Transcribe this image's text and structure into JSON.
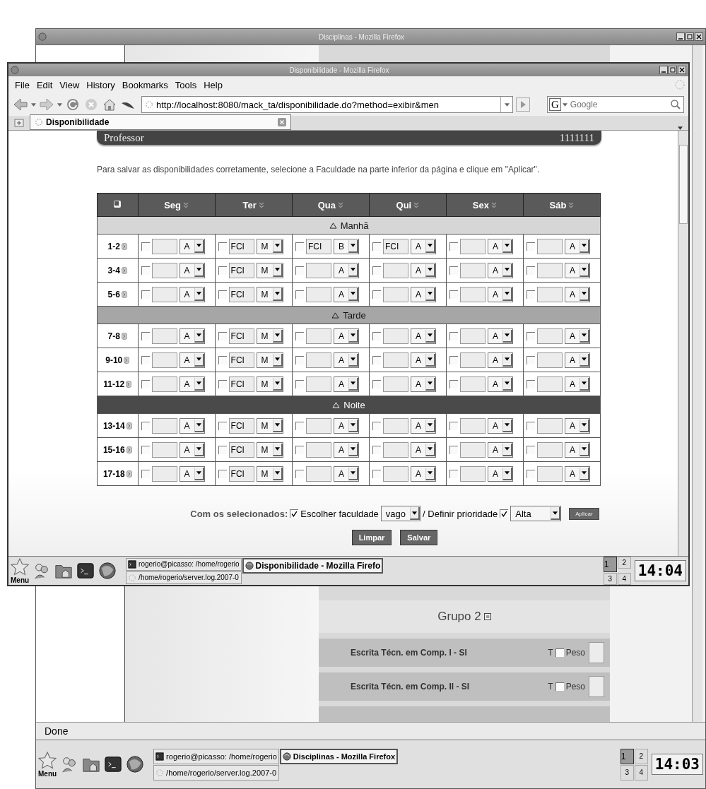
{
  "back_window": {
    "title": "Disciplinas - Mozilla Firefox",
    "group_title": "Grupo 2",
    "subjects": [
      {
        "name": "Escrita Técn. em Comp. I - SI",
        "t_label": "T",
        "checked": false,
        "weight_label": "Peso"
      },
      {
        "name": "Escrita Técn. em Comp. II - SI",
        "t_label": "T",
        "checked": false,
        "weight_label": "Peso"
      }
    ],
    "status": "Done",
    "taskbar": {
      "menu": "Menu",
      "tasks": [
        {
          "label": "rogerio@picasso: /home/rogerio",
          "kind": "terminal",
          "selected": false
        },
        {
          "label": "/home/rogerio/server.log.2007-0",
          "kind": "file",
          "selected": false
        },
        {
          "label": "Disciplinas - Mozilla Firefox",
          "kind": "browser",
          "selected": true
        }
      ],
      "workspaces": [
        {
          "label": "1",
          "selected": true
        },
        {
          "label": "2",
          "selected": false
        },
        {
          "label": "3",
          "selected": false
        },
        {
          "label": "4",
          "selected": false
        }
      ],
      "clock": "14:03"
    }
  },
  "front_window": {
    "title": "Disponibilidade - Mozilla Firefox",
    "menu": [
      "File",
      "Edit",
      "View",
      "History",
      "Bookmarks",
      "Tools",
      "Help"
    ],
    "url": "http://localhost:8080/mack_ta/disponibilidade.do?method=exibir&men",
    "search_engine": "G",
    "search_placeholder": "Google",
    "tab": {
      "label": "Disponibilidade",
      "selected": true
    },
    "page": {
      "header_title": "Professor",
      "header_id": "1111111",
      "instruction": "Para salvar as disponibilidades corretamente, selecione a Faculdade na parte inferior da página e clique em \"Aplicar\".",
      "columns": [
        "Seg",
        "Ter",
        "Qua",
        "Qui",
        "Sex",
        "Sáb"
      ],
      "sections": [
        {
          "label": "Manhã",
          "color": "#d6d6d6",
          "rows": [
            {
              "label": "1-2",
              "cells": [
                {
                  "checked": false,
                  "priority": "A"
                },
                {
                  "checked": false,
                  "faculty": "FCI",
                  "priority": "M"
                },
                {
                  "checked": false,
                  "faculty": "FCI",
                  "priority": "B"
                },
                {
                  "checked": false,
                  "faculty": "FCI",
                  "priority": "A"
                },
                {
                  "checked": false,
                  "priority": "A"
                },
                {
                  "checked": false,
                  "priority": "A"
                }
              ]
            },
            {
              "label": "3-4",
              "cells": [
                {
                  "checked": false,
                  "priority": "A"
                },
                {
                  "checked": false,
                  "faculty": "FCI",
                  "priority": "M"
                },
                {
                  "checked": false,
                  "priority": "A"
                },
                {
                  "checked": false,
                  "priority": "A"
                },
                {
                  "checked": false,
                  "priority": "A"
                },
                {
                  "checked": false,
                  "priority": "A"
                }
              ]
            },
            {
              "label": "5-6",
              "cells": [
                {
                  "checked": false,
                  "priority": "A"
                },
                {
                  "checked": false,
                  "faculty": "FCI",
                  "priority": "M"
                },
                {
                  "checked": false,
                  "priority": "A"
                },
                {
                  "checked": false,
                  "priority": "A"
                },
                {
                  "checked": false,
                  "priority": "A"
                },
                {
                  "checked": false,
                  "priority": "A"
                }
              ]
            }
          ]
        },
        {
          "label": "Tarde",
          "color": "#a6a6a6",
          "rows": [
            {
              "label": "7-8",
              "cells": [
                {
                  "checked": false,
                  "priority": "A"
                },
                {
                  "checked": false,
                  "faculty": "FCI",
                  "priority": "M"
                },
                {
                  "checked": false,
                  "priority": "A"
                },
                {
                  "checked": false,
                  "priority": "A"
                },
                {
                  "checked": false,
                  "priority": "A"
                },
                {
                  "checked": false,
                  "priority": "A"
                }
              ]
            },
            {
              "label": "9-10",
              "cells": [
                {
                  "checked": false,
                  "priority": "A"
                },
                {
                  "checked": false,
                  "faculty": "FCI",
                  "priority": "M"
                },
                {
                  "checked": false,
                  "priority": "A"
                },
                {
                  "checked": false,
                  "priority": "A"
                },
                {
                  "checked": false,
                  "priority": "A"
                },
                {
                  "checked": false,
                  "priority": "A"
                }
              ]
            },
            {
              "label": "11-12",
              "cells": [
                {
                  "checked": false,
                  "priority": "A"
                },
                {
                  "checked": false,
                  "faculty": "FCI",
                  "priority": "M"
                },
                {
                  "checked": false,
                  "priority": "A"
                },
                {
                  "checked": false,
                  "priority": "A"
                },
                {
                  "checked": false,
                  "priority": "A"
                },
                {
                  "checked": false,
                  "priority": "A"
                }
              ]
            }
          ]
        },
        {
          "label": "Noite",
          "color": "#4a4a4a",
          "rows": [
            {
              "label": "13-14",
              "cells": [
                {
                  "checked": false,
                  "priority": "A"
                },
                {
                  "checked": false,
                  "faculty": "FCI",
                  "priority": "M"
                },
                {
                  "checked": false,
                  "priority": "A"
                },
                {
                  "checked": false,
                  "priority": "A"
                },
                {
                  "checked": false,
                  "priority": "A"
                },
                {
                  "checked": false,
                  "priority": "A"
                }
              ]
            },
            {
              "label": "15-16",
              "cells": [
                {
                  "checked": false,
                  "priority": "A"
                },
                {
                  "checked": false,
                  "faculty": "FCI",
                  "priority": "M"
                },
                {
                  "checked": false,
                  "priority": "A"
                },
                {
                  "checked": false,
                  "priority": "A"
                },
                {
                  "checked": false,
                  "priority": "A"
                },
                {
                  "checked": false,
                  "priority": "A"
                }
              ]
            },
            {
              "label": "17-18",
              "cells": [
                {
                  "checked": false,
                  "priority": "A"
                },
                {
                  "checked": false,
                  "faculty": "FCI",
                  "priority": "M"
                },
                {
                  "checked": false,
                  "priority": "A"
                },
                {
                  "checked": false,
                  "priority": "A"
                },
                {
                  "checked": false,
                  "priority": "A"
                },
                {
                  "checked": false,
                  "priority": "A"
                }
              ]
            }
          ]
        }
      ],
      "bulk": {
        "label": "Com os selecionados:",
        "faculty_checked": true,
        "faculty_label": "Escolher faculdade",
        "faculty_value": "vago",
        "priority_label": "/ Definir prioridade",
        "priority_checked": true,
        "priority_value": "Alta",
        "apply": "Aplicar"
      },
      "buttons": [
        "Limpar",
        "Salvar"
      ]
    },
    "taskbar": {
      "menu": "Menu",
      "tasks": [
        {
          "label": "rogerio@picasso: /home/rogerio",
          "kind": "terminal",
          "selected": false
        },
        {
          "label": "/home/rogerio/server.log.2007-0",
          "kind": "file",
          "selected": false
        },
        {
          "label": "Disponibilidade - Mozilla Firefo",
          "kind": "browser",
          "selected": true
        }
      ],
      "workspaces": [
        {
          "label": "1",
          "selected": true
        },
        {
          "label": "2",
          "selected": false
        },
        {
          "label": "3",
          "selected": false
        },
        {
          "label": "4",
          "selected": false
        }
      ],
      "clock": "14:04"
    }
  }
}
